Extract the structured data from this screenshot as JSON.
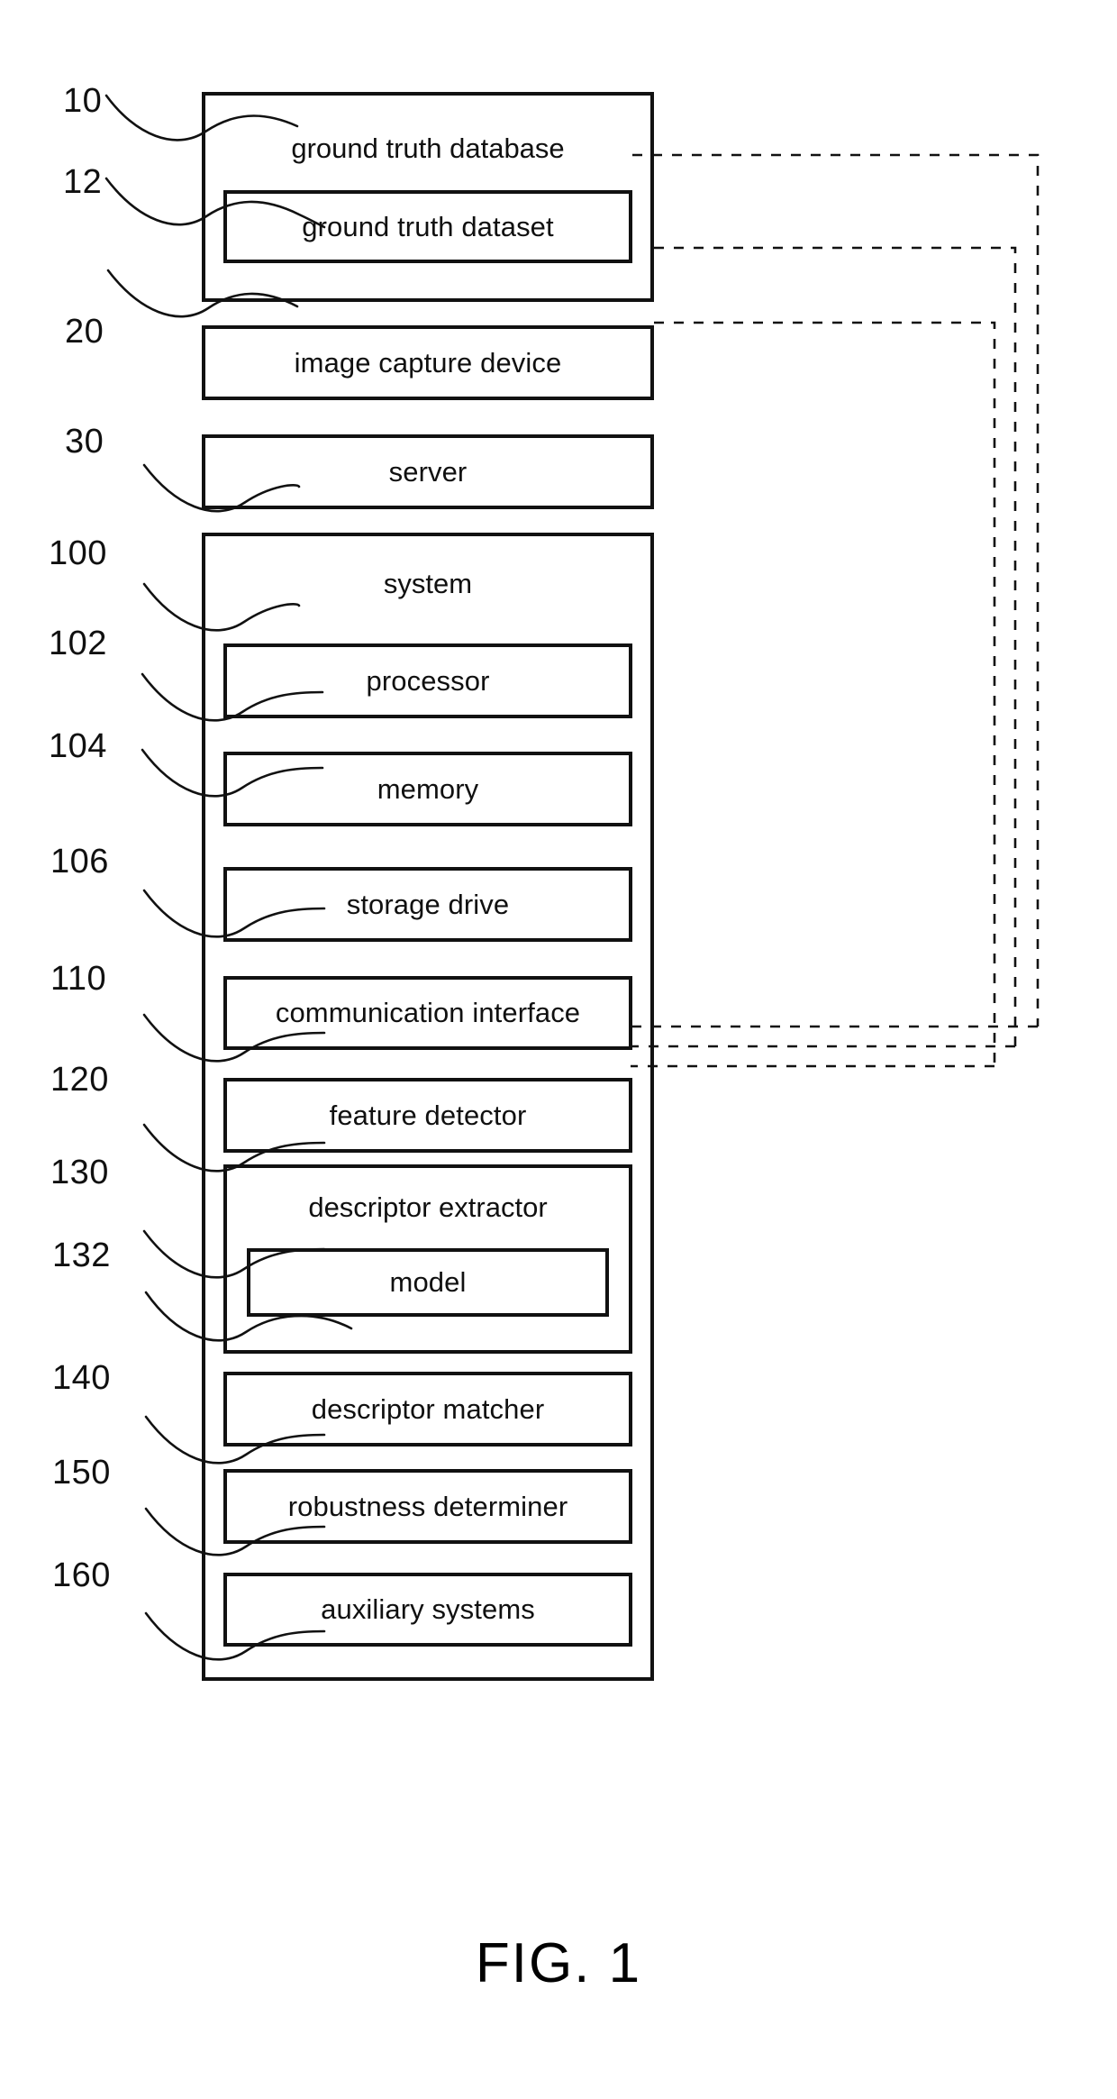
{
  "figure": {
    "caption": "FIG. 1",
    "boxes": {
      "ground_truth_database": "ground truth database",
      "ground_truth_dataset": "ground truth dataset",
      "image_capture_device": "image capture device",
      "server": "server",
      "system": "system",
      "processor": "processor",
      "memory": "memory",
      "storage_drive": "storage drive",
      "communication_interface": "communication interface",
      "feature_detector": "feature detector",
      "descriptor_extractor": "descriptor extractor",
      "model": "model",
      "descriptor_matcher": "descriptor matcher",
      "robustness_determiner": "robustness determiner",
      "auxiliary_systems": "auxiliary systems"
    },
    "reference_numerals": {
      "ground_truth_database": "10",
      "ground_truth_dataset": "12",
      "image_capture_device": "20",
      "server": "30",
      "system": "100",
      "processor": "102",
      "memory": "104",
      "storage_drive": "106",
      "communication_interface": "110",
      "feature_detector": "120",
      "descriptor_extractor": "130",
      "model": "132",
      "descriptor_matcher": "140",
      "robustness_determiner": "150",
      "auxiliary_systems": "160"
    },
    "colors": {
      "line": "#111111",
      "text": "#101010",
      "background": "#ffffff"
    }
  }
}
